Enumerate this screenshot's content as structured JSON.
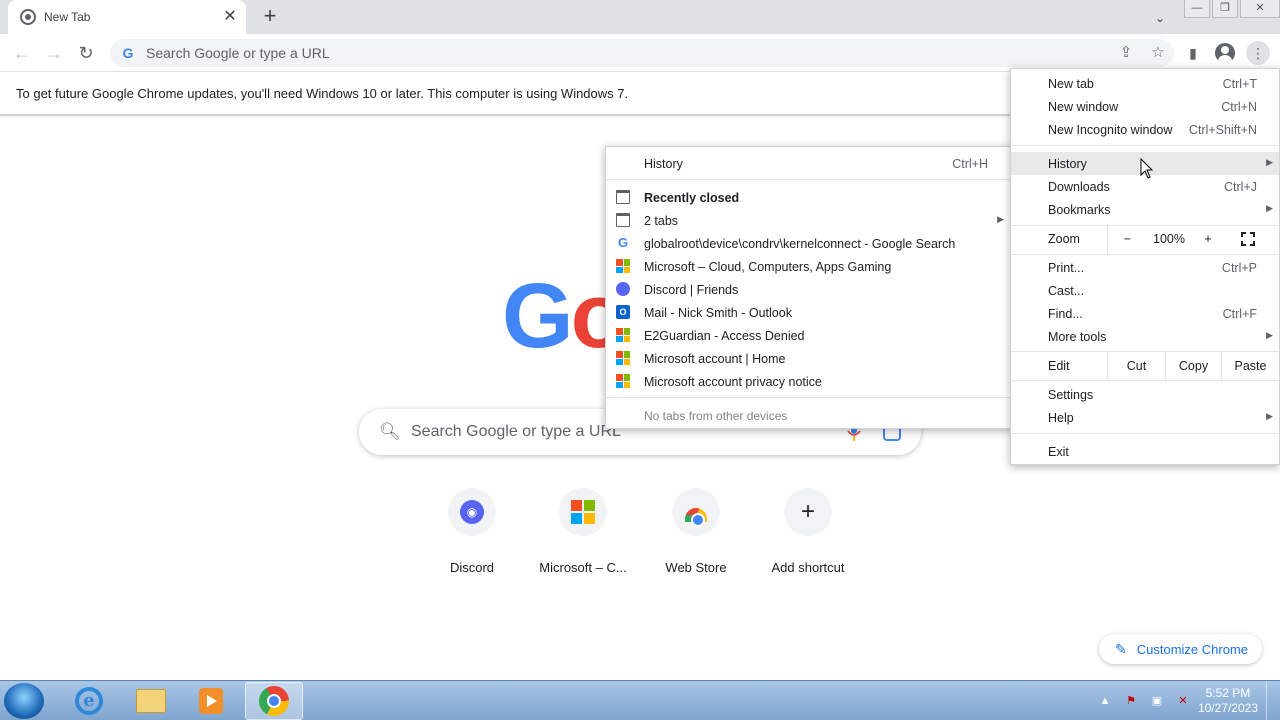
{
  "tab": {
    "title": "New Tab",
    "close": "✕",
    "new_tab": "+"
  },
  "tabsearch": "⌄",
  "window": {
    "minimize": "—",
    "restore": "❐",
    "close": "✕"
  },
  "omnibox": {
    "placeholder": "Search Google or type a URL",
    "g": "G"
  },
  "infobar": {
    "text": "To get future Google Chrome updates, you'll need Windows 10 or later. This computer is using Windows 7."
  },
  "ntp": {
    "logo": [
      "G",
      "o"
    ],
    "logo_colors": [
      "#4285f4",
      "#ea4335"
    ],
    "search_placeholder": "Search Google or type a URL",
    "shortcuts": [
      {
        "label": "Discord",
        "icon": "discord-icon"
      },
      {
        "label": "Microsoft – C...",
        "icon": "microsoft-icon"
      },
      {
        "label": "Web Store",
        "icon": "webstore-icon"
      },
      {
        "label": "Add shortcut",
        "icon": "plus-icon"
      }
    ],
    "customize": "Customize Chrome",
    "add_symbol": "+"
  },
  "menu": {
    "new_tab": {
      "label": "New tab",
      "shortcut": "Ctrl+T"
    },
    "new_window": {
      "label": "New window",
      "shortcut": "Ctrl+N"
    },
    "new_incognito": {
      "label": "New Incognito window",
      "shortcut": "Ctrl+Shift+N"
    },
    "history": {
      "label": "History"
    },
    "downloads": {
      "label": "Downloads",
      "shortcut": "Ctrl+J"
    },
    "bookmarks": {
      "label": "Bookmarks"
    },
    "zoom": {
      "label": "Zoom",
      "minus": "−",
      "value": "100%",
      "plus": "+"
    },
    "print": {
      "label": "Print...",
      "shortcut": "Ctrl+P"
    },
    "cast": {
      "label": "Cast..."
    },
    "find": {
      "label": "Find...",
      "shortcut": "Ctrl+F"
    },
    "more_tools": {
      "label": "More tools"
    },
    "edit": {
      "label": "Edit",
      "cut": "Cut",
      "copy": "Copy",
      "paste": "Paste"
    },
    "settings": {
      "label": "Settings"
    },
    "help": {
      "label": "Help"
    },
    "exit": {
      "label": "Exit"
    },
    "arrow": "▶"
  },
  "history_menu": {
    "history": {
      "label": "History",
      "shortcut": "Ctrl+H"
    },
    "recently_closed": "Recently closed",
    "items": [
      {
        "label": "2 tabs",
        "icon": "window-icon"
      },
      {
        "label": "globalroot\\device\\condrv\\kernelconnect - Google Search",
        "icon": "google-icon"
      },
      {
        "label": "Microsoft – Cloud, Computers, Apps  Gaming",
        "icon": "microsoft-icon"
      },
      {
        "label": "Discord | Friends",
        "icon": "discord-icon"
      },
      {
        "label": "Mail - Nick Smith - Outlook",
        "icon": "outlook-icon"
      },
      {
        "label": "E2Guardian - Access Denied",
        "icon": "microsoft-icon"
      },
      {
        "label": "Microsoft account | Home",
        "icon": "microsoft-icon"
      },
      {
        "label": "Microsoft account privacy notice",
        "icon": "microsoft-icon"
      }
    ],
    "no_tabs": "No tabs from other devices"
  },
  "taskbar": {
    "clock_time": "5:52 PM",
    "clock_date": "10/27/2023"
  },
  "colors": {
    "ms_red": "#f25022",
    "ms_green": "#7fba00",
    "ms_blue": "#00a4ef",
    "ms_yellow": "#ffb900",
    "accent": "#1a73e8"
  }
}
